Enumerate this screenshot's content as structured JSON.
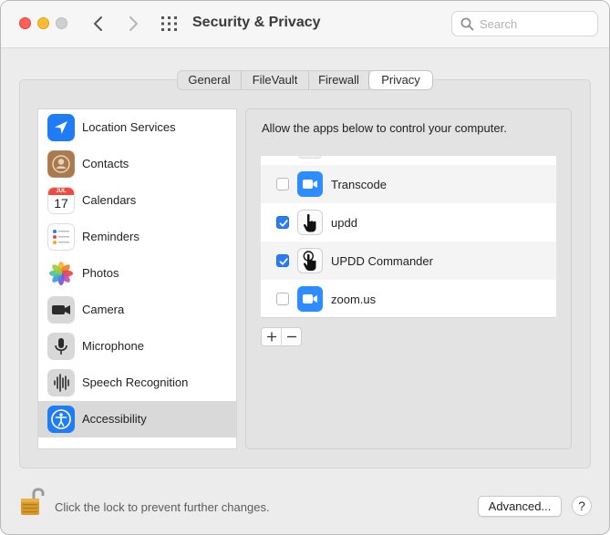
{
  "window": {
    "title": "Security & Privacy"
  },
  "search": {
    "placeholder": "Search"
  },
  "tabs": [
    {
      "label": "General"
    },
    {
      "label": "FileVault"
    },
    {
      "label": "Firewall"
    },
    {
      "label": "Privacy",
      "selected": true
    }
  ],
  "sidebar": {
    "items": [
      {
        "label": "Location Services",
        "icon": "location-arrow-icon"
      },
      {
        "label": "Contacts",
        "icon": "contacts-icon"
      },
      {
        "label": "Calendars",
        "icon": "calendar-icon",
        "icon_month": "JUL",
        "icon_day": "17"
      },
      {
        "label": "Reminders",
        "icon": "reminders-icon"
      },
      {
        "label": "Photos",
        "icon": "photos-icon"
      },
      {
        "label": "Camera",
        "icon": "camera-icon"
      },
      {
        "label": "Microphone",
        "icon": "microphone-icon"
      },
      {
        "label": "Speech Recognition",
        "icon": "waveform-icon"
      },
      {
        "label": "Accessibility",
        "icon": "accessibility-icon",
        "selected": true
      }
    ]
  },
  "panel": {
    "title": "Allow the apps below to control your computer.",
    "apps": [
      {
        "label": "Transcode",
        "checked": false,
        "icon": "zoom-video-icon"
      },
      {
        "label": "updd",
        "checked": true,
        "icon": "hand-pointer-icon"
      },
      {
        "label": "UPDD Commander",
        "checked": true,
        "icon": "hand-touch-icon"
      },
      {
        "label": "zoom.us",
        "checked": false,
        "icon": "zoom-video-icon"
      }
    ],
    "add_label": "+",
    "remove_label": "–"
  },
  "footer": {
    "lock_text": "Click the lock to prevent further changes.",
    "advanced_label": "Advanced...",
    "help_label": "?"
  },
  "colors": {
    "accent": "#2a7cf6",
    "close": "#fe5f57",
    "minimize": "#febc2e",
    "zoom_blue": "#2d8cff",
    "selection": "#d9d9d9"
  }
}
